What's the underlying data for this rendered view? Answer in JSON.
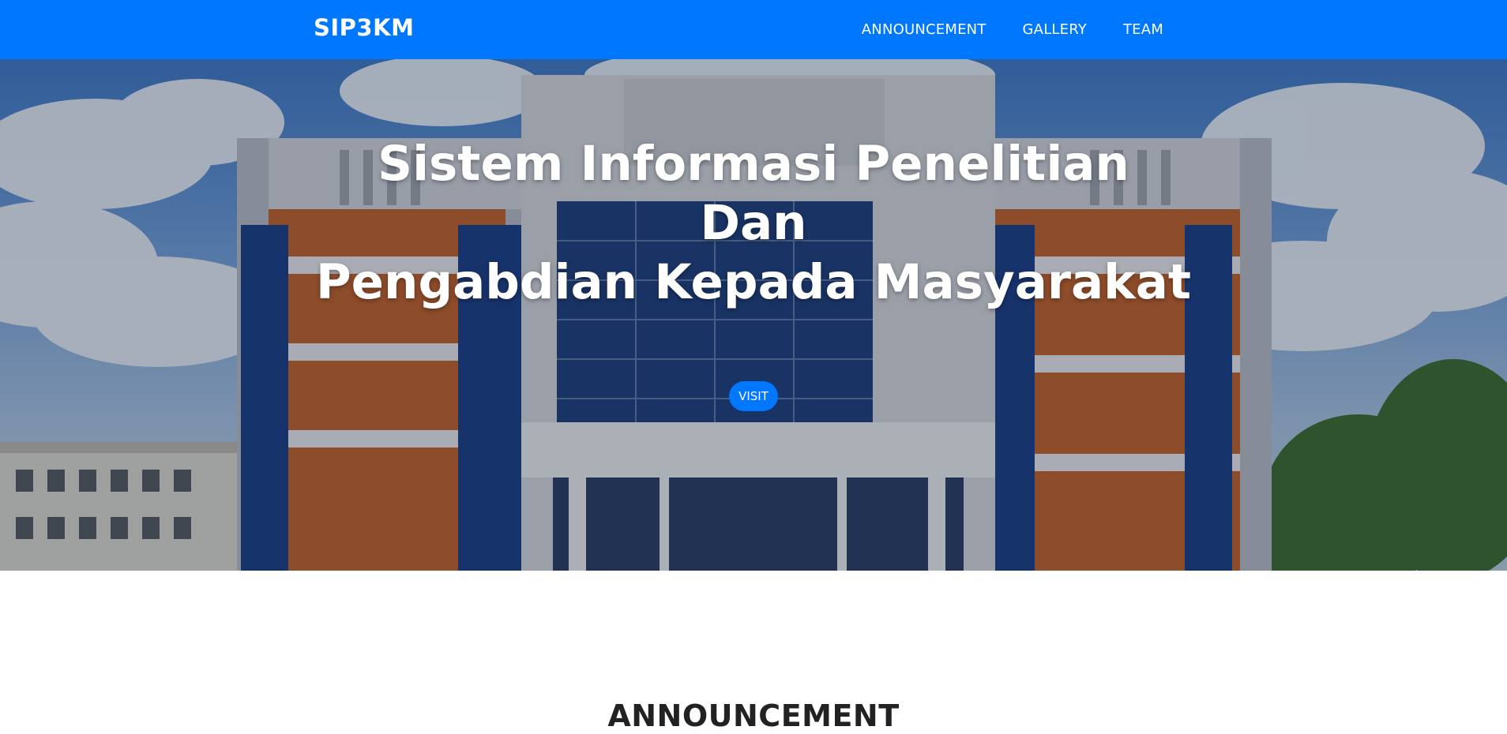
{
  "navbar": {
    "brand": "SIP3KM",
    "links": [
      "ANNOUNCEMENT",
      "GALLERY",
      "TEAM"
    ],
    "background_color": "#0077ff"
  },
  "hero": {
    "title_lines": [
      "Sistem Informasi Penelitian",
      "Dan",
      "Pengabdian Kepada Masyarakat"
    ],
    "button_label": "VISIT",
    "button_color": "#0077ff"
  },
  "announcement": {
    "heading": "ANNOUNCEMENT"
  }
}
